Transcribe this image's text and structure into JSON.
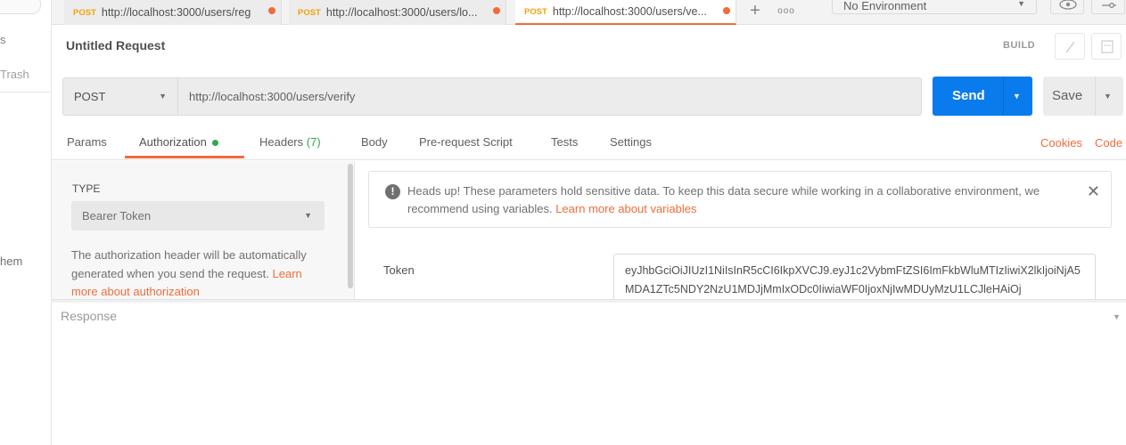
{
  "sidebar": {
    "partial_label_1": "s",
    "trash_label": "Trash",
    "partial_label_2": "hem"
  },
  "tabs": [
    {
      "method": "POST",
      "url": "http://localhost:3000/users/reg"
    },
    {
      "method": "POST",
      "url": "http://localhost:3000/users/lo..."
    },
    {
      "method": "POST",
      "url": "http://localhost:3000/users/ve..."
    }
  ],
  "tab_more_icon": "ooo",
  "environment": {
    "selected": "No Environment"
  },
  "request": {
    "title": "Untitled Request",
    "build_label": "BUILD",
    "method": "POST",
    "url": "http://localhost:3000/users/verify",
    "send_label": "Send",
    "save_label": "Save"
  },
  "subtabs": {
    "params": "Params",
    "authorization": "Authorization",
    "headers": "Headers",
    "headers_count": "(7)",
    "body": "Body",
    "pre_request_script": "Pre-request Script",
    "tests": "Tests",
    "settings": "Settings",
    "cookies": "Cookies",
    "code": "Code"
  },
  "auth": {
    "type_label": "TYPE",
    "type_value": "Bearer Token",
    "description": "The authorization header will be automatically generated when you send the request.",
    "learn_more": "Learn more about authorization",
    "alert_text": "Heads up! These parameters hold sensitive data. To keep this data secure while working in a collaborative environment, we recommend using variables.",
    "alert_link": "Learn more about variables",
    "token_label": "Token",
    "token_value": "eyJhbGciOiJIUzI1NiIsInR5cCI6IkpXVCJ9.eyJ1c2VybmFtZSI6ImFkbWluMTIzIiwiX2lkIjoiNjA5MDA1ZTc5NDY2NzU1MDJjMmIxODc0IiwiaWF0IjoxNjIwMDUyMzU1LCJleHAiOj"
  },
  "response": {
    "label": "Response"
  },
  "colors": {
    "accent": "#f26b3a",
    "send_blue": "#097bed",
    "method_post": "#f1a20b",
    "status_green": "#2fa84f"
  }
}
